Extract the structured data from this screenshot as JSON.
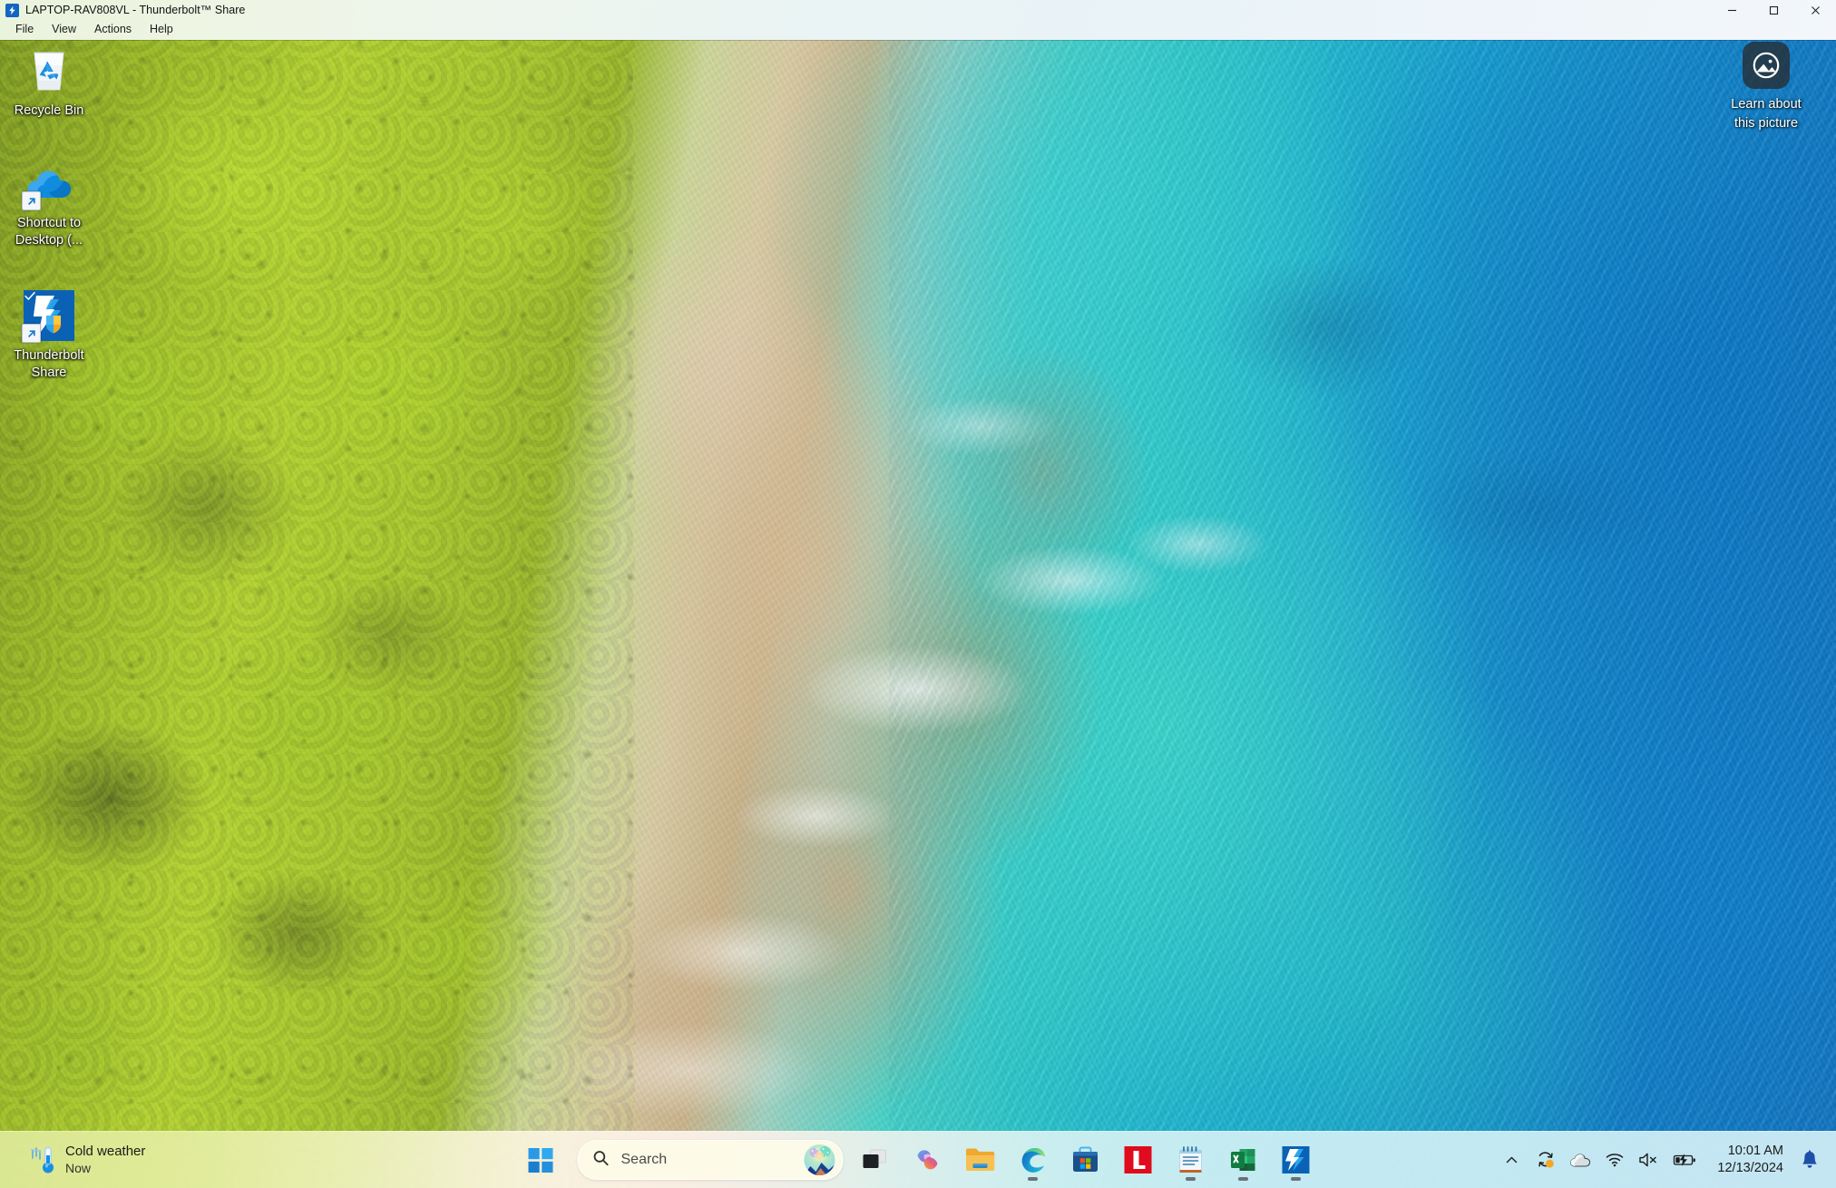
{
  "window": {
    "title": "LAPTOP-RAV808VL - Thunderbolt™ Share",
    "app_icon": "thunderbolt-icon",
    "menu": [
      {
        "label": "File"
      },
      {
        "label": "View"
      },
      {
        "label": "Actions"
      },
      {
        "label": "Help"
      }
    ],
    "controls": [
      {
        "name": "minimize",
        "glyph": "—"
      },
      {
        "name": "maximize",
        "glyph": "□"
      },
      {
        "name": "close",
        "glyph": "✕"
      }
    ]
  },
  "desktop": {
    "icons": [
      {
        "label": "Recycle Bin",
        "icon": "recycle-bin-icon",
        "shortcut": false,
        "synced": false
      },
      {
        "label": "Shortcut to Desktop (...",
        "icon": "onedrive-cloud-icon",
        "shortcut": true,
        "synced": false
      },
      {
        "label": "Thunderbolt Share",
        "icon": "thunderbolt-share-icon",
        "shortcut": true,
        "synced": true
      }
    ],
    "learn_widget": {
      "line1": "Learn about",
      "line2": "this picture",
      "icon": "picture-info-icon"
    }
  },
  "taskbar": {
    "weather": {
      "title": "Cold weather",
      "subtitle": "Now",
      "icon": "thermometer-cold-icon"
    },
    "start_label": "Start",
    "search": {
      "placeholder": "Search",
      "icon": "search-icon",
      "discover_icon": "bing-discover-icon"
    },
    "task_view_label": "Task view",
    "apps": [
      {
        "name": "copilot",
        "label": "Copilot",
        "running": false
      },
      {
        "name": "file-explorer",
        "label": "File Explorer",
        "running": false
      },
      {
        "name": "edge",
        "label": "Microsoft Edge",
        "running": true
      },
      {
        "name": "microsoft-store",
        "label": "Microsoft Store",
        "running": false
      },
      {
        "name": "lenovo-vantage",
        "label": "L",
        "running": false
      },
      {
        "name": "notepad",
        "label": "Notepad",
        "running": true
      },
      {
        "name": "excel",
        "label": "Excel",
        "running": true
      },
      {
        "name": "thunderbolt-share",
        "label": "Thunderbolt Share",
        "running": true
      }
    ],
    "tray": {
      "overflow_label": "Show hidden icons",
      "items": [
        {
          "name": "windows-update-icon",
          "label": "Windows Update",
          "badge": true
        },
        {
          "name": "onedrive-icon",
          "label": "OneDrive",
          "badge": false
        },
        {
          "name": "wifi-icon",
          "label": "Network",
          "badge": false
        },
        {
          "name": "volume-muted-icon",
          "label": "Volume muted",
          "badge": false
        },
        {
          "name": "battery-charging-icon",
          "label": "Battery charging",
          "badge": false
        }
      ],
      "clock": {
        "time": "10:01 AM",
        "date": "12/13/2024"
      },
      "notification_icon": "notification-bell-icon"
    }
  },
  "colors": {
    "accent": "#0a66c2",
    "taskbar_left": "#dde997",
    "taskbar_right": "#cdedf5",
    "badge_orange": "#f5a623",
    "bell_blue": "#1f4fa8"
  }
}
